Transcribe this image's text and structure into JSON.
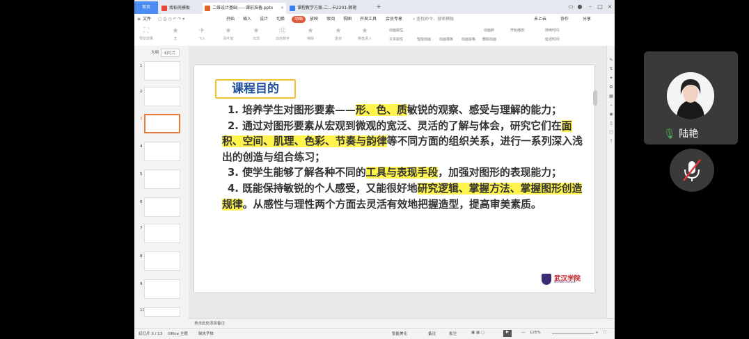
{
  "titlebar": {
    "home_tab": "首页",
    "tabs": [
      {
        "label": "找稻壳模板",
        "icon_color": "#e8473c"
      },
      {
        "label": "二维设计基础——课前准备.pptx",
        "icon_color": "#e2632a"
      },
      {
        "label": "课程教学方案-二...卡2201-顾艳",
        "icon_color": "#3b7ef3"
      }
    ]
  },
  "menubar": {
    "items": [
      "文件",
      "开始",
      "插入",
      "设计",
      "切换",
      "动画",
      "放映",
      "审阅",
      "视图",
      "开发工具",
      "会员专享"
    ],
    "active": "动画",
    "search_placeholder": "查找命令、搜索模板",
    "right": [
      "未上云",
      "协作",
      "分享"
    ]
  },
  "ribbon": {
    "items": [
      "预览效果",
      "无",
      "飞入",
      "百叶窗",
      "出现",
      "动态数字",
      "擦除",
      "盒状",
      "棋盘进入"
    ],
    "side_left": [
      "动画属性",
      "文本属性"
    ],
    "mid": [
      "智能动画",
      "动画模板",
      "动画窗格",
      "删除动画"
    ],
    "right": [
      "动画刷",
      "开始播放:",
      "持续时间:",
      "延迟时间:"
    ]
  },
  "panel": {
    "tabs": [
      "大纲",
      "幻灯片"
    ],
    "slide_numbers": [
      "1",
      "2",
      "3",
      "4",
      "5",
      "6",
      "7",
      "8",
      "9",
      "10"
    ],
    "current": "3"
  },
  "slide": {
    "title": "课程目的",
    "p1": {
      "a": "1. 培养学生对图形要素——",
      "h": "形、色、质",
      "b": "敏锐的观察、感受与理解的能力；"
    },
    "p2": {
      "a": "2. 通过对图形要素从宏观到微观的宽泛、灵活的了解与体会，研究它们在",
      "h": "面积、空间、肌理、色彩、节奏与韵律",
      "b": "等不同方面的组织关系，进行一系列深入浅出的创造与组合练习；"
    },
    "p3": {
      "a": "3. 使学生能够了解各种不同的",
      "h": "工具与表现手段",
      "b": "，加强对图形的表现能力；"
    },
    "p4": {
      "a": "4. 既能保持敏锐的个人感受，又能很好地",
      "h": "研究逻辑、掌握方法、掌握图形创造规律",
      "b": "。从感性与理性两个方面去灵活有效地把握造型，提高审美素质。"
    },
    "logo_name": "武汉学院",
    "logo_en": "WUHAN COLLEGE"
  },
  "notes_placeholder": "单击此处添加备注",
  "status": {
    "slide_info": "幻灯片 3 / 13",
    "theme": "Office 主题",
    "font_warning": "缺失字体",
    "beautify": "智能美化",
    "notes": "备注",
    "comments": "批注",
    "zoom": "125%"
  },
  "video": {
    "name": "陆艳",
    "accent": "#4caf50"
  }
}
